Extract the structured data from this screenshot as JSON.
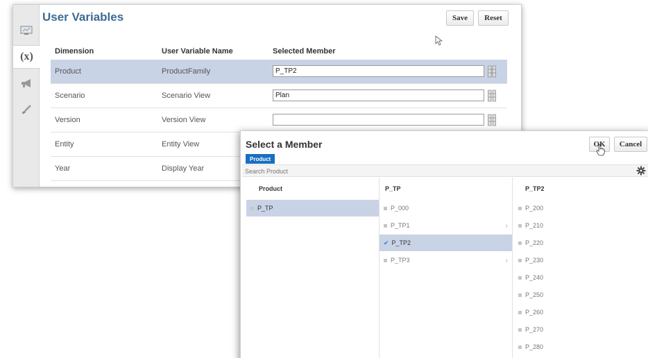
{
  "user_variables": {
    "title": "User Variables",
    "save_label": "Save",
    "reset_label": "Reset",
    "columns": [
      "Dimension",
      "User Variable Name",
      "Selected Member"
    ],
    "rows": [
      {
        "dimension": "Product",
        "variable": "ProductFamily",
        "member": "P_TP2",
        "has_input": true
      },
      {
        "dimension": "Scenario",
        "variable": "Scenario View",
        "member": "Plan",
        "has_input": true
      },
      {
        "dimension": "Version",
        "variable": "Version View",
        "member": "",
        "has_input": true
      },
      {
        "dimension": "Entity",
        "variable": "Entity View",
        "member": "",
        "has_input": false
      },
      {
        "dimension": "Year",
        "variable": "Display Year",
        "member": "",
        "has_input": false
      }
    ],
    "sidebar_icons": [
      "monitor-icon",
      "variable-icon",
      "megaphone-icon",
      "brush-icon"
    ],
    "variable_glyph": "(x)"
  },
  "select_member": {
    "title": "Select a Member",
    "ok_label": "OK",
    "cancel_label": "Cancel",
    "tab_label": "Product",
    "search_placeholder": "Search Product",
    "col1": {
      "header": "Product",
      "items": [
        "P_TP"
      ]
    },
    "col2": {
      "header": "P_TP",
      "items": [
        "P_000",
        "P_TP1",
        "P_TP2",
        "P_TP3"
      ]
    },
    "col3": {
      "header": "P_TP2",
      "items": [
        "P_200",
        "P_210",
        "P_220",
        "P_230",
        "P_240",
        "P_250",
        "P_260",
        "P_270",
        "P_280"
      ]
    }
  },
  "colors": {
    "title_blue": "#3c6b95",
    "selection": "#c9d3e6",
    "tab_blue": "#1a6ec1"
  }
}
